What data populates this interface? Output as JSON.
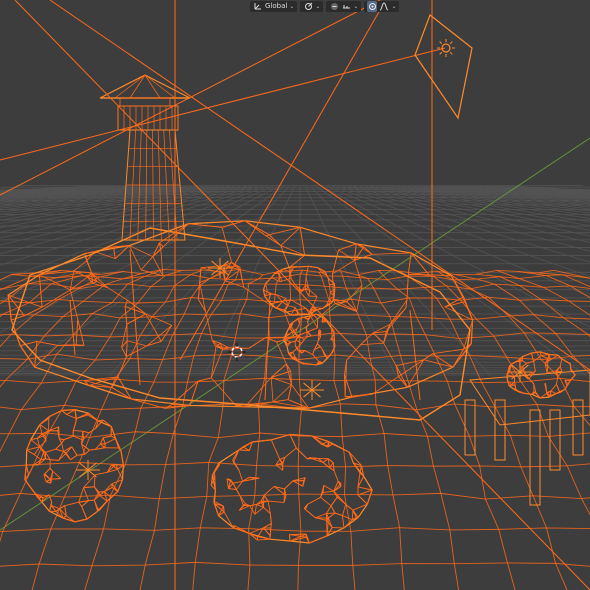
{
  "header": {
    "transform_orientation": "Global",
    "pivot_icon": "transform-pivot-icon",
    "snap_icon": "snap-icon",
    "proportional_icon": "proportional-editing-icon",
    "falloff_icon": "falloff-curve-icon"
  },
  "viewport": {
    "mode": "wireframe",
    "colors": {
      "background": "#3d3d3d",
      "grid": "#535353",
      "selection_wire": "#ff6a1a",
      "selection_wire_bright": "#ff8a2a",
      "y_axis": "#6aa03a",
      "cursor": "#e0452a"
    },
    "objects": [
      "lighthouse",
      "island",
      "rock-left",
      "rock-front",
      "pier",
      "sun-lamp",
      "camera"
    ]
  }
}
